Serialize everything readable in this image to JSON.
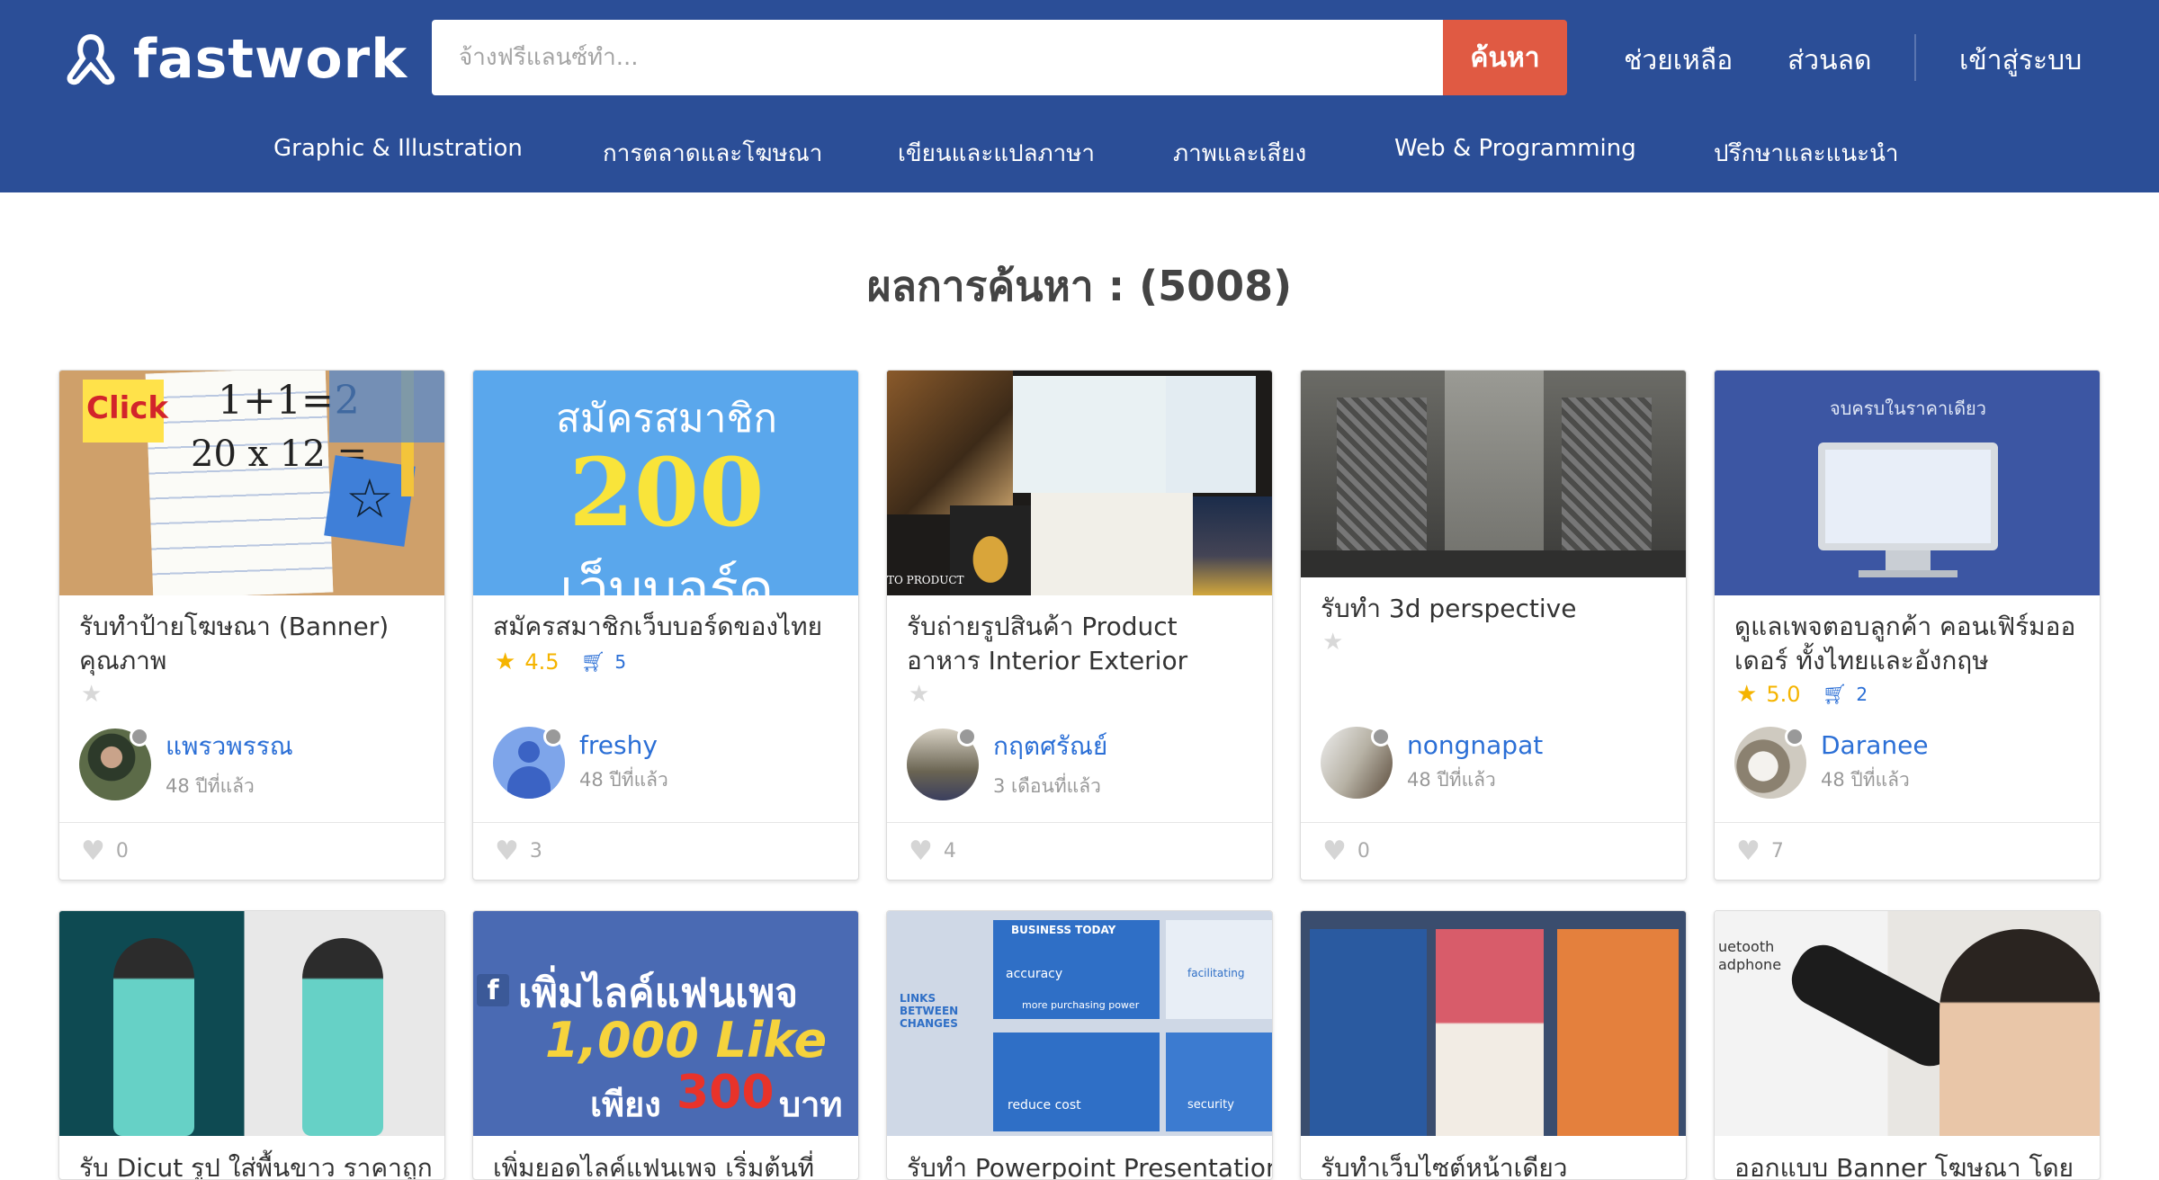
{
  "brand": {
    "name": "fastwork"
  },
  "search": {
    "placeholder": "จ้างฟรีแลนซ์ทำ...",
    "button_label": "ค้นหา"
  },
  "top_links": {
    "help": "ช่วยเหลือ",
    "discount": "ส่วนลด",
    "login": "เข้าสู่ระบบ"
  },
  "categories": [
    "Graphic & Illustration",
    "การตลาดและโฆษณา",
    "เขียนและแปลภาษา",
    "ภาพและเสียง",
    "Web & Programming",
    "ปรึกษาและแนะนำ"
  ],
  "results": {
    "title": "ผลการค้นหา : (5008)"
  },
  "cards": [
    {
      "title": "รับทำป้ายโฆษณา (Banner) คุณภาพ",
      "rating": "",
      "orders": "",
      "seller": "แพรวพรรณ",
      "time": "48 ปีที่แล้ว",
      "likes": "0",
      "thumb_text": [
        "Click",
        "1+1=2",
        "20 x 12 ="
      ]
    },
    {
      "title": "สมัครสมาชิกเว็บบอร์ดของไทย",
      "rating": "4.5",
      "orders": "5",
      "seller": "freshy",
      "time": "48 ปีที่แล้ว",
      "likes": "3",
      "thumb_text": [
        "สมัครสมาชิก",
        "200",
        "เว็บบอร์ด"
      ]
    },
    {
      "title": "รับถ่ายรูปสินค้า Product อาหาร Interior Exterior",
      "rating": "",
      "orders": "",
      "seller": "กฤตศรัณย์",
      "time": "3 เดือนที่แล้ว",
      "likes": "4",
      "thumb_text": [
        "TO PRODUCT"
      ]
    },
    {
      "title": "รับทำ 3d perspective",
      "rating": "",
      "orders": "",
      "seller": "nongnapat",
      "time": "48 ปีที่แล้ว",
      "likes": "0",
      "thumb_text": []
    },
    {
      "title": "ดูแลเพจตอบลูกค้า คอนเฟิร์มออเดอร์ ทั้งไทยและอังกฤษ",
      "rating": "5.0",
      "orders": "2",
      "seller": "Daranee",
      "time": "48 ปีที่แล้ว",
      "likes": "7",
      "thumb_text": [
        "จบครบในราคาเดียว"
      ]
    }
  ],
  "cards_row2": [
    {
      "title": "รับ Dicut รูป ใส่พื้นขาว ราคาถูก"
    },
    {
      "title": "เพิ่มยอดไลค์แฟนเพจ เริ่มต้นที่",
      "thumb_text": [
        "เพิ่มไลค์แฟนเพจ",
        "1,000 Like",
        "เพียง",
        "300",
        "บาท"
      ]
    },
    {
      "title": "รับทำ Powerpoint Presentation",
      "thumb_text": [
        "BUSINESS TODAY",
        "accuracy",
        "more purchasing power",
        "LINKS BETWEEN CHANGES",
        "reduce cost",
        "security",
        "facilitating"
      ]
    },
    {
      "title": "รับทำเว็บไซต์หน้าเดียว"
    },
    {
      "title": "ออกแบบ Banner โฆษณา โดย",
      "thumb_text": [
        "uetooth",
        "adphone"
      ]
    }
  ],
  "colors": {
    "header": "#2b4e97",
    "search_button": "#e05a43",
    "link": "#2b6fd6",
    "star": "#f5b400"
  }
}
